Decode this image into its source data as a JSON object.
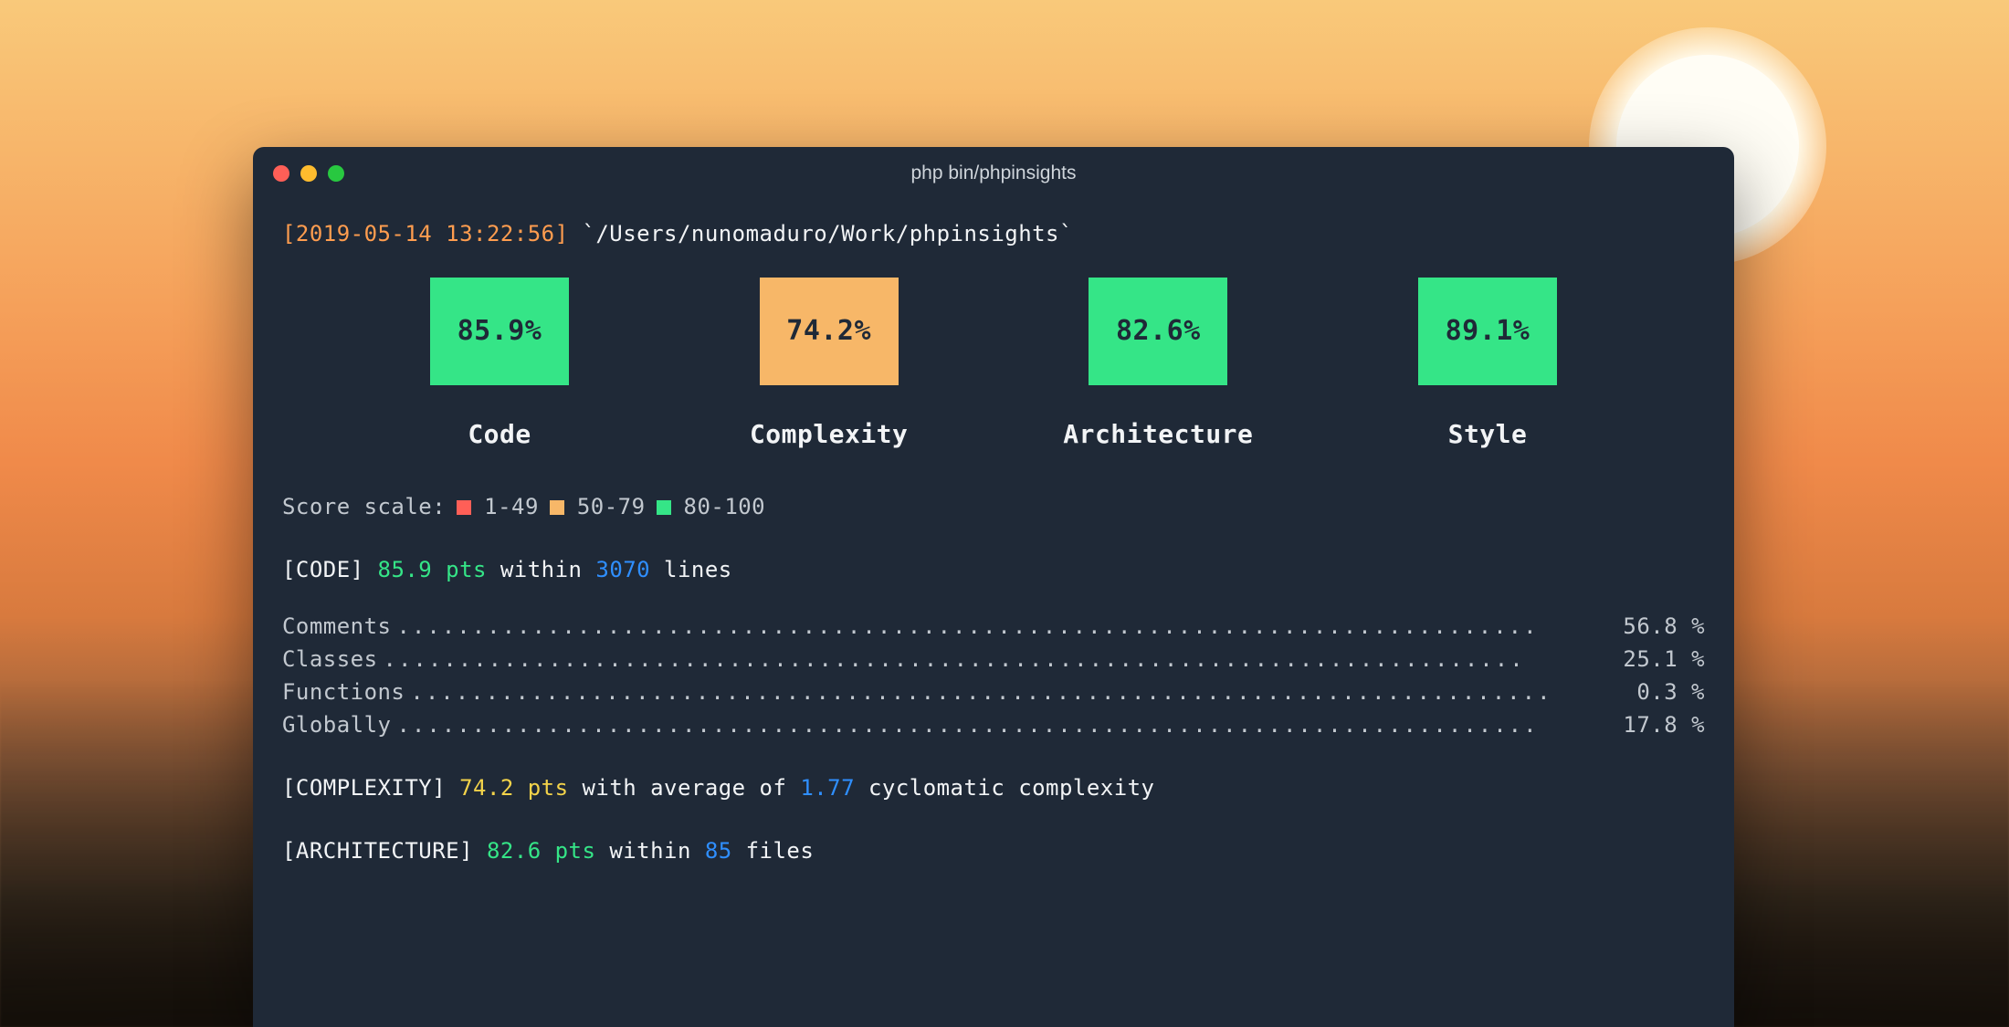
{
  "window": {
    "title": "php bin/phpinsights"
  },
  "header": {
    "timestamp": "[2019-05-14 13:22:56]",
    "path": "`/Users/nunomaduro/Work/phpinsights`"
  },
  "metrics": [
    {
      "value": "85.9%",
      "label": "Code",
      "color": "green"
    },
    {
      "value": "74.2%",
      "label": "Complexity",
      "color": "orange"
    },
    {
      "value": "82.6%",
      "label": "Architecture",
      "color": "green"
    },
    {
      "value": "89.1%",
      "label": "Style",
      "color": "green"
    }
  ],
  "scale": {
    "prefix": "Score scale:",
    "ranges": [
      {
        "color": "red",
        "label": "1-49"
      },
      {
        "color": "orange",
        "label": "50-79"
      },
      {
        "color": "green",
        "label": "80-100"
      }
    ]
  },
  "sections": {
    "code": {
      "tag": "[CODE]",
      "pts": "85.9 pts",
      "mid": " within ",
      "num": "3070",
      "tail": " lines",
      "breakdown": [
        {
          "label": "Comments",
          "value": "56.8 %"
        },
        {
          "label": "Classes",
          "value": "25.1 %"
        },
        {
          "label": "Functions",
          "value": "0.3 %"
        },
        {
          "label": "Globally",
          "value": "17.8 %"
        }
      ]
    },
    "complexity": {
      "tag": "[COMPLEXITY]",
      "pts": "74.2 pts",
      "mid": " with average of ",
      "num": "1.77",
      "tail": " cyclomatic complexity"
    },
    "architecture": {
      "tag": "[ARCHITECTURE]",
      "pts": "82.6 pts",
      "mid": " within ",
      "num": "85",
      "tail": " files"
    }
  },
  "colors": {
    "green": "#35e587",
    "orange": "#f7b768",
    "red": "#ff5f57",
    "terminal_bg": "#1f2937"
  }
}
